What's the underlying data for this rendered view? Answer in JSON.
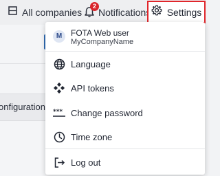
{
  "header": {
    "all_companies_label": "All companies",
    "notifications_label": "Notifications",
    "notifications_count": "2",
    "settings_label": "Settings"
  },
  "background": {
    "row_text": "Configuration"
  },
  "menu": {
    "user": {
      "avatar_letter": "M",
      "name": "FOTA Web user",
      "company": "MyCompanyName"
    },
    "items": [
      {
        "label": "Language",
        "icon": "globe-icon"
      },
      {
        "label": "API tokens",
        "icon": "api-tokens-icon"
      },
      {
        "label": "Change password",
        "icon": "password-icon"
      },
      {
        "label": "Time zone",
        "icon": "clock-icon"
      },
      {
        "label": "Log out",
        "icon": "logout-icon"
      }
    ]
  },
  "colors": {
    "accent_red": "#e0262b",
    "badge_red": "#d9262c",
    "brand_blue": "#2f6bb3"
  }
}
